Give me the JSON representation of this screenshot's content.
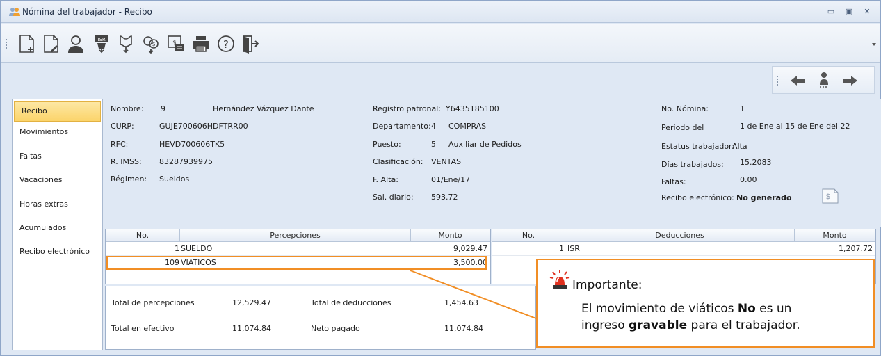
{
  "window": {
    "title": "Nómina del trabajador - Recibo"
  },
  "toolbar": {
    "buttons": [
      "new-document-icon",
      "edit-document-icon",
      "employee-icon",
      "isr-icon",
      "receipt-download-icon",
      "money-icon",
      "invoice-icon",
      "print-icon",
      "help-icon",
      "exit-icon"
    ]
  },
  "sidebar": {
    "items": [
      {
        "label": "Recibo",
        "active": true
      },
      {
        "label": "Movimientos"
      },
      {
        "label": "Faltas"
      },
      {
        "label": "Vacaciones"
      },
      {
        "label": "Horas extras"
      },
      {
        "label": "Acumulados"
      },
      {
        "label": "Recibo electrónico"
      }
    ]
  },
  "employee": {
    "nombre_label": "Nombre:",
    "nombre_num": "9",
    "nombre": "Hernández Vázquez Dante",
    "curp_label": "CURP:",
    "curp": "GUJE700606HDFTRR00",
    "rfc_label": "RFC:",
    "rfc": "HEVD700606TK5",
    "imss_label": "R. IMSS:",
    "imss": "83287939975",
    "regimen_label": "Régimen:",
    "regimen": "Sueldos",
    "registro_label": "Registro patronal:",
    "registro": "Y6435185100",
    "depto_label": "Departamento:",
    "depto_num": "4",
    "depto": "COMPRAS",
    "puesto_label": "Puesto:",
    "puesto_num": "5",
    "puesto": "Auxiliar de Pedidos",
    "clasif_label": "Clasificación:",
    "clasif": "VENTAS",
    "alta_label": "F. Alta:",
    "alta": "01/Ene/17",
    "sal_label": "Sal. diario:",
    "sal": "593.72",
    "nomina_label": "No. Nómina:",
    "nomina": "1",
    "periodo_label": "Periodo del",
    "periodo": "1 de Ene al 15 de Ene del 22",
    "estatus_label": "Estatus trabajador:",
    "estatus": "Alta",
    "dias_label": "Días trabajados:",
    "dias": "15.2083",
    "faltas_label": "Faltas:",
    "faltas": "0.00",
    "recibo_label": "Recibo electrónico:",
    "recibo": "No generado"
  },
  "percepciones": {
    "headers": [
      "No.",
      "Percepciones",
      "Monto"
    ],
    "rows": [
      {
        "no": "1",
        "concepto": "SUELDO",
        "monto": "9,029.47"
      },
      {
        "no": "109",
        "concepto": "VIATICOS",
        "monto": "3,500.00"
      }
    ]
  },
  "deducciones": {
    "headers": [
      "No.",
      "Deducciones",
      "Monto"
    ],
    "rows": [
      {
        "no": "1",
        "concepto": "ISR",
        "monto": "1,207.72"
      }
    ]
  },
  "totals": {
    "percepciones_label": "Total de percepciones",
    "percepciones": "12,529.47",
    "deducciones_label": "Total de deducciones",
    "deducciones": "1,454.63",
    "efectivo_label": "Total en efectivo",
    "efectivo": "11,074.84",
    "neto_label": "Neto pagado",
    "neto": "11,074.84"
  },
  "callout": {
    "title": "Importante:",
    "line1_a": "El movimiento de viáticos ",
    "line1_b": "No",
    "line1_c": " es un",
    "line2_a": "ingreso ",
    "line2_b": "gravable",
    "line2_c": " para el trabajador."
  },
  "colors": {
    "accent": "#f18e25",
    "active_tab": "#fbd46a",
    "panel": "#dfe8f4"
  }
}
